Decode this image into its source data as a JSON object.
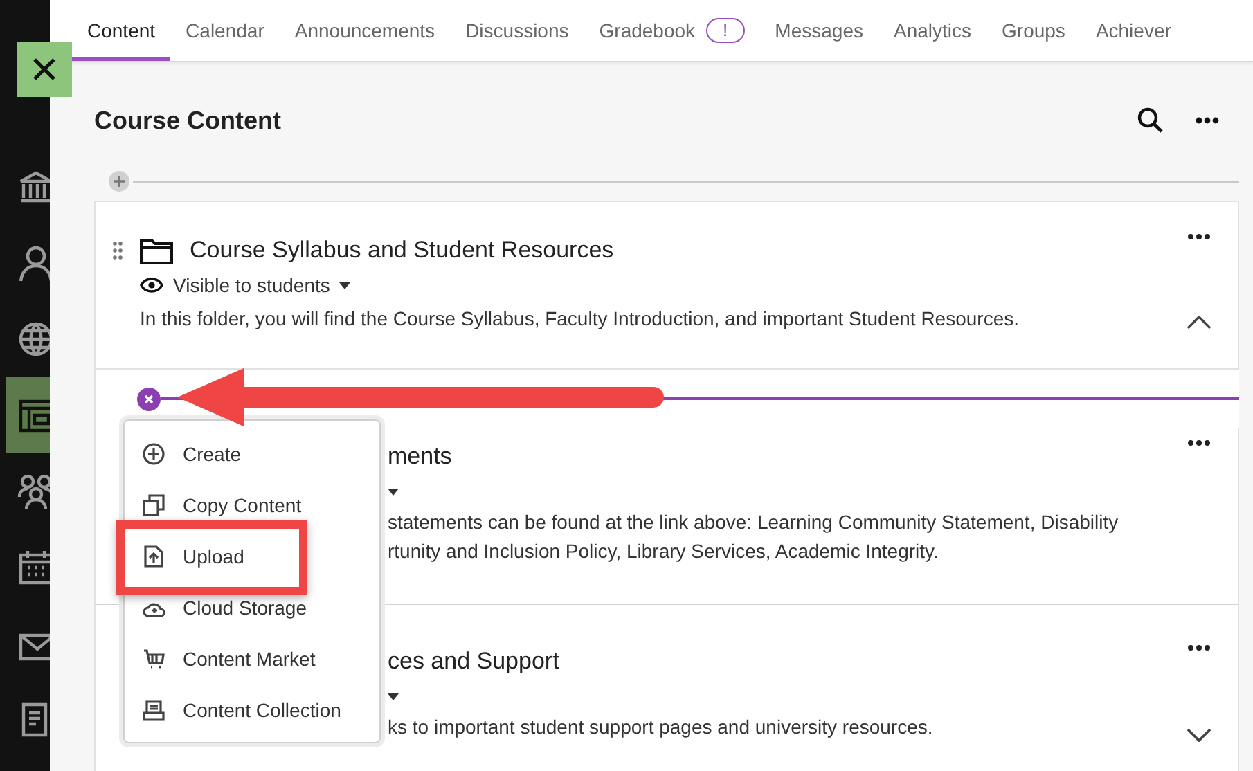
{
  "sidebar": {
    "items": [
      {
        "selected": false
      },
      {
        "selected": false
      },
      {
        "selected": false
      },
      {
        "selected": true
      },
      {
        "selected": false
      },
      {
        "selected": false
      },
      {
        "selected": false
      },
      {
        "selected": false
      }
    ]
  },
  "tabs": [
    {
      "label": "Content",
      "selected": true
    },
    {
      "label": "Calendar",
      "selected": false
    },
    {
      "label": "Announcements",
      "selected": false
    },
    {
      "label": "Discussions",
      "selected": false
    },
    {
      "label": "Gradebook",
      "selected": false,
      "badge": "!"
    },
    {
      "label": "Messages",
      "selected": false
    },
    {
      "label": "Analytics",
      "selected": false
    },
    {
      "label": "Groups",
      "selected": false
    },
    {
      "label": "Achiever",
      "selected": false
    }
  ],
  "page_title": "Course Content",
  "rows": [
    {
      "kind": "add-bar",
      "open": false
    },
    {
      "kind": "item",
      "title": "Course Syllabus and Student Resources",
      "visibility": "Visible to students",
      "description": [
        "In this folder, you will find the Course Syllabus, Faculty Introduction, and important Student Resources."
      ],
      "expanded": true
    },
    {
      "kind": "add-bar",
      "open": true
    },
    {
      "kind": "covered-item",
      "title": "ments",
      "description": [
        "statements can be found at the link above: Learning Community Statement, Disability",
        "rtunity and Inclusion Policy, Library Services, Academic Integrity."
      ]
    },
    {
      "kind": "covered-item",
      "title": "ces and Support",
      "description": [
        "ks to important student support pages and university resources."
      ],
      "expanded": false
    }
  ],
  "add_menu": [
    {
      "label": "Create",
      "highlighted": false
    },
    {
      "label": "Copy Content",
      "highlighted": false
    },
    {
      "label": "Upload",
      "highlighted": true
    },
    {
      "label": "Cloud Storage",
      "highlighted": false
    },
    {
      "label": "Content Market",
      "highlighted": false
    },
    {
      "label": "Content Collection",
      "highlighted": false
    }
  ]
}
